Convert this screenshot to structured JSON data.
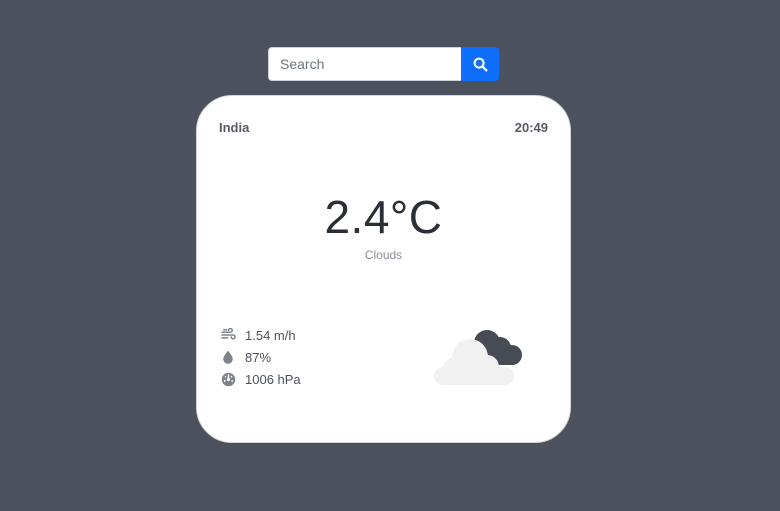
{
  "search": {
    "placeholder": "Search",
    "value": "",
    "button_icon": "search-icon"
  },
  "card": {
    "city": "India",
    "time": "20:49",
    "temperature": "2.4°C",
    "condition": "Clouds",
    "stats": {
      "wind": {
        "icon": "wind-icon",
        "value": "1.54 m/h"
      },
      "humidity": {
        "icon": "droplet-icon",
        "value": "87%"
      },
      "pressure": {
        "icon": "gauge-icon",
        "value": "1006 hPa"
      }
    },
    "weather_icon": "clouds-icon"
  },
  "colors": {
    "background": "#4b515d",
    "card": "#ffffff",
    "accent": "#0d6efd",
    "text_muted": "#8a8f98"
  }
}
